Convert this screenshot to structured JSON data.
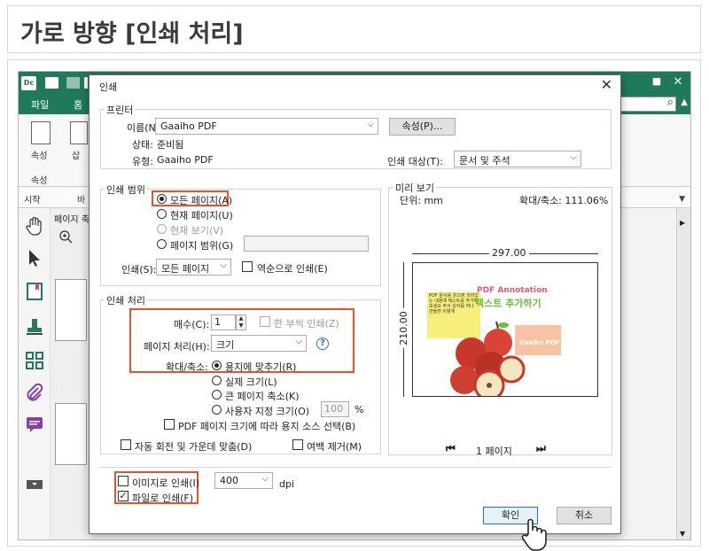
{
  "page": {
    "title": "가로 방향 [인쇄 처리]"
  },
  "app": {
    "logo": "Dc",
    "ribbon_tabs": [
      "파일",
      "홈"
    ],
    "ribbon": {
      "properties_label": "속성",
      "insert_label": "삽",
      "group_label": "속성"
    },
    "doc_tabs": [
      "시작",
      "바"
    ],
    "panel_label": "페이지 축"
  },
  "dialog": {
    "title": "인쇄",
    "printer": {
      "group": "프린터",
      "name_label": "이름(N):",
      "name_value": "Gaaiho PDF",
      "properties_button": "속성(P)...",
      "status_label": "상태:",
      "status_value": "준비됨",
      "type_label": "유형:",
      "type_value": "Gaaiho PDF",
      "target_label": "인쇄 대상(T):",
      "target_value": "문서 및 주석"
    },
    "range": {
      "group": "인쇄 범위",
      "all_pages": "모든 페이지(A)",
      "current_page": "현재 페이지(U)",
      "current_view": "현재 보기(V)",
      "page_range": "페이지 범위(G)",
      "print_label": "인쇄(S):",
      "print_value": "모든 페이지",
      "reverse": "역순으로 인쇄(E)"
    },
    "handling": {
      "group": "인쇄 처리",
      "copies_label": "매수(C):",
      "copies_value": "1",
      "collate": "한 부씩 인쇄(Z)",
      "page_handling_label": "페이지 처리(H):",
      "page_handling_value": "크기",
      "help": "?",
      "scale_label": "확대/축소:",
      "fit": "용지에 맞추기(R)",
      "actual": "실제 크기(L)",
      "shrink": "큰 페이지 축소(K)",
      "custom": "사용자 지정 크기(O)",
      "custom_value": "100",
      "percent": "%",
      "paper_source": "PDF 페이지 크기에 따라 용지 소스 선택(B)",
      "auto_rotate": "자동 회전 및 가운데 맞춤(D)",
      "remove_margin": "여백 제거(M)"
    },
    "preview": {
      "group": "미리 보기",
      "unit": "단위: mm",
      "zoom": "확대/축소: 111.06%",
      "width": "297.00",
      "height": "210.00",
      "page_nav": "1 페이지",
      "doc_heading": "PDF Annotation",
      "doc_subheading": "텍스트 추가하기",
      "doc_box": "PDF 문서를 읽으며 의미있는 내용에 텍스트를 추가해 보세요 주석 상자를 하나 만들면 이렇게",
      "doc_stamp": "Gaaiho PDF"
    },
    "image_print": "이미지로 인쇄(I)",
    "dpi_value": "400",
    "dpi_label": "dpi",
    "file_print": "파일로 인쇄(F)",
    "ok_button": "확인",
    "cancel_button": "취소"
  },
  "colors": {
    "accent": "#1f7a5a",
    "highlight": "#e8532d",
    "app_bg": "#f3f3f3"
  }
}
